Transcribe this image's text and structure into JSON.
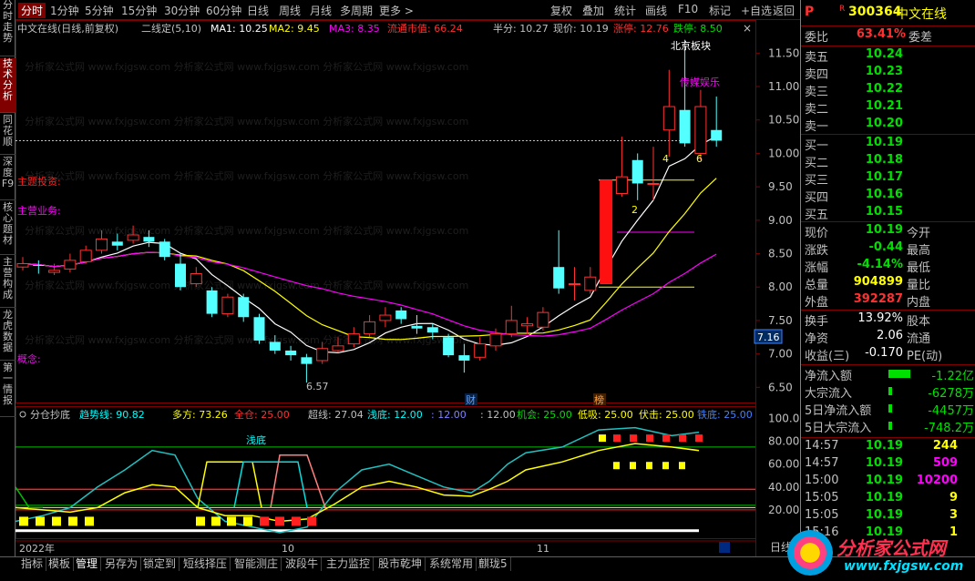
{
  "topbar": {
    "tabs": [
      "分时",
      "1分钟",
      "5分钟",
      "15分钟",
      "30分钟",
      "60分钟",
      "日线",
      "周线",
      "月线",
      "多周期",
      "更多 >"
    ],
    "active_tab": "分时",
    "right_tools": [
      "复权",
      "叠加",
      "统计",
      "画线",
      "F10",
      "标记",
      "+自选",
      "返回"
    ]
  },
  "leftbar": {
    "items": [
      "分时走势",
      "技术分析",
      "同花顺",
      "深度F9",
      "核心题材",
      "主营构成",
      "龙虎数据",
      "第一情报"
    ],
    "active": "技术分析"
  },
  "stock": {
    "code": "300364",
    "name": "中文在线",
    "p_mark": "P",
    "r_mark": "R"
  },
  "main_chart_header": {
    "title": "中文在线(日线,前复权)",
    "indicator": "二线定(5,10)",
    "ma1": "MA1: 10.25",
    "ma2": "MA2: 9.45",
    "ma3": "MA3: 8.35",
    "float_cap": "流通市值: 66.24",
    "half": "半分: 10.27",
    "price_now": "现价: 10.19",
    "limit_up": "涨停: 12.76",
    "limit_down": "跌停: 8.50",
    "close_btn": "×"
  },
  "main_chart_labels": {
    "theme": "主题投资:",
    "business": "主营业务:",
    "concept": "概念:",
    "beijing": "北京板块",
    "media": "传媒娱乐",
    "low_price": "6.57",
    "mark_cai": "财",
    "mark_bang": "榜",
    "n4": "4",
    "n6": "6",
    "n2": "2",
    "price_tag": "7.16"
  },
  "price_axis": [
    "11.50",
    "11.00",
    "10.50",
    "10.00",
    "9.50",
    "9.00",
    "8.50",
    "8.00",
    "7.50",
    "7.00",
    "6.50"
  ],
  "sub_chart_header": {
    "name": "分仓抄底",
    "trend": "趋势线: 90.82",
    "long": "多方: 73.26",
    "full": "全仓: 25.00",
    "super": "超线: 27.04",
    "shallow": "浅底: 12.00",
    "v12": ": 12.00",
    "v12b": ": 12.00",
    "chance": "机会: 25.00",
    "low_buy": "低吸: 25.00",
    "ambush": "伏击: 25.00",
    "iron": "铁底: 25.00",
    "shallow_label": "浅底"
  },
  "sub_axis": [
    "100.00",
    "80.00",
    "60.00",
    "40.00",
    "20.00"
  ],
  "date_axis": {
    "year": "2022年",
    "m10": "10",
    "m11": "11"
  },
  "right_panel": {
    "weibi_label": "委比",
    "weibi_val": "63.41%",
    "weicha_label": "委差",
    "sells": [
      {
        "label": "卖五",
        "price": "10.24"
      },
      {
        "label": "卖四",
        "price": "10.23"
      },
      {
        "label": "卖三",
        "price": "10.22"
      },
      {
        "label": "卖二",
        "price": "10.21"
      },
      {
        "label": "卖一",
        "price": "10.20"
      }
    ],
    "buys": [
      {
        "label": "买一",
        "price": "10.19"
      },
      {
        "label": "买二",
        "price": "10.18"
      },
      {
        "label": "买三",
        "price": "10.17"
      },
      {
        "label": "买四",
        "price": "10.16"
      },
      {
        "label": "买五",
        "price": "10.15"
      }
    ],
    "quotes": [
      {
        "l1": "现价",
        "v1": "10.19",
        "l2": "今开",
        "c": "green"
      },
      {
        "l1": "涨跌",
        "v1": "-0.44",
        "l2": "最高",
        "c": "green"
      },
      {
        "l1": "涨幅",
        "v1": "-4.14%",
        "l2": "最低",
        "c": "green"
      },
      {
        "l1": "总量",
        "v1": "904899",
        "l2": "量比",
        "c": "yellow"
      },
      {
        "l1": "外盘",
        "v1": "392287",
        "l2": "内盘",
        "c": "red"
      }
    ],
    "extra": [
      {
        "l1": "换手",
        "v1": "13.92%",
        "l2": "股本"
      },
      {
        "l1": "净资",
        "v1": "2.06",
        "l2": "流通"
      },
      {
        "l1": "收益(三)",
        "v1": "-0.170",
        "l2": "PE(动)"
      }
    ],
    "flows": [
      {
        "label": "净流入额",
        "val": "-1.22亿"
      },
      {
        "label": "大宗流入",
        "val": "-6278万"
      },
      {
        "label": "5日净流入额",
        "val": "-4457万"
      },
      {
        "label": "5日大宗流入",
        "val": "-748.2万"
      }
    ],
    "ticks": [
      {
        "time": "14:57",
        "price": "10.19",
        "vol": "244",
        "c": "yellow"
      },
      {
        "time": "14:57",
        "price": "10.19",
        "vol": "509",
        "c": "magenta"
      },
      {
        "time": "15:00",
        "price": "10.19",
        "vol": "10200",
        "c": "magenta"
      },
      {
        "time": "15:05",
        "price": "10.19",
        "vol": "9",
        "c": "yellow"
      },
      {
        "time": "15:05",
        "price": "10.19",
        "vol": "3",
        "c": "yellow"
      },
      {
        "time": "15:16",
        "price": "10.19",
        "vol": "1",
        "c": "yellow"
      }
    ]
  },
  "bottombar": {
    "items": [
      "指标",
      "模板",
      "管理",
      "另存为",
      "锁定到",
      "短线择压",
      "智能测庄",
      "波段牛",
      "主力监控",
      "股市乾坤",
      "系统常用",
      "麒珑5"
    ],
    "right": "日线"
  },
  "watermark": {
    "site": "分析家公式网",
    "url": "www.fxjgsw.com"
  },
  "chart_data": {
    "type": "candlestick",
    "ylim": [
      6.3,
      11.75
    ],
    "candles": [
      {
        "o": 8.3,
        "c": 8.35,
        "h": 8.45,
        "l": 8.25
      },
      {
        "o": 8.33,
        "c": 8.32,
        "h": 8.4,
        "l": 8.2
      },
      {
        "o": 8.22,
        "c": 8.25,
        "h": 8.35,
        "l": 8.18
      },
      {
        "o": 8.27,
        "c": 8.4,
        "h": 8.5,
        "l": 8.22
      },
      {
        "o": 8.38,
        "c": 8.55,
        "h": 8.62,
        "l": 8.35
      },
      {
        "o": 8.55,
        "c": 8.72,
        "h": 8.85,
        "l": 8.5
      },
      {
        "o": 8.68,
        "c": 8.62,
        "h": 8.8,
        "l": 8.55
      },
      {
        "o": 8.7,
        "c": 8.78,
        "h": 8.92,
        "l": 8.65
      },
      {
        "o": 8.75,
        "c": 8.68,
        "h": 8.85,
        "l": 8.6
      },
      {
        "o": 8.68,
        "c": 8.45,
        "h": 8.72,
        "l": 8.4
      },
      {
        "o": 8.35,
        "c": 8.0,
        "h": 8.5,
        "l": 7.95
      },
      {
        "o": 8.05,
        "c": 8.2,
        "h": 8.3,
        "l": 8.0
      },
      {
        "o": 7.95,
        "c": 7.6,
        "h": 8.0,
        "l": 7.55
      },
      {
        "o": 7.6,
        "c": 7.85,
        "h": 7.9,
        "l": 7.55
      },
      {
        "o": 7.85,
        "c": 7.55,
        "h": 7.9,
        "l": 7.48
      },
      {
        "o": 7.55,
        "c": 7.2,
        "h": 7.6,
        "l": 7.15
      },
      {
        "o": 7.18,
        "c": 7.05,
        "h": 7.28,
        "l": 7.0
      },
      {
        "o": 7.05,
        "c": 6.98,
        "h": 7.12,
        "l": 6.9
      },
      {
        "o": 6.95,
        "c": 6.85,
        "h": 7.0,
        "l": 6.57
      },
      {
        "o": 6.9,
        "c": 7.08,
        "h": 7.18,
        "l": 6.85
      },
      {
        "o": 7.05,
        "c": 7.12,
        "h": 7.25,
        "l": 7.02
      },
      {
        "o": 7.15,
        "c": 7.3,
        "h": 7.4,
        "l": 7.1
      },
      {
        "o": 7.3,
        "c": 7.48,
        "h": 7.58,
        "l": 7.25
      },
      {
        "o": 7.5,
        "c": 7.58,
        "h": 7.7,
        "l": 7.4
      },
      {
        "o": 7.65,
        "c": 7.52,
        "h": 7.7,
        "l": 7.45
      },
      {
        "o": 7.42,
        "c": 7.38,
        "h": 7.58,
        "l": 7.3
      },
      {
        "o": 7.4,
        "c": 7.32,
        "h": 7.45,
        "l": 7.22
      },
      {
        "o": 7.25,
        "c": 6.98,
        "h": 7.3,
        "l": 6.95
      },
      {
        "o": 6.98,
        "c": 6.9,
        "h": 7.15,
        "l": 6.72
      },
      {
        "o": 6.95,
        "c": 7.15,
        "h": 7.25,
        "l": 6.9
      },
      {
        "o": 7.12,
        "c": 7.3,
        "h": 7.38,
        "l": 7.05
      },
      {
        "o": 7.3,
        "c": 7.5,
        "h": 7.72,
        "l": 7.25
      },
      {
        "o": 7.42,
        "c": 7.45,
        "h": 7.55,
        "l": 7.3
      },
      {
        "o": 7.4,
        "c": 7.62,
        "h": 7.7,
        "l": 7.35
      },
      {
        "o": 8.3,
        "c": 7.98,
        "h": 8.85,
        "l": 7.9
      },
      {
        "o": 8.05,
        "c": 8.05,
        "h": 8.3,
        "l": 7.8
      },
      {
        "o": 7.95,
        "c": 8.15,
        "h": 8.3,
        "l": 7.9
      },
      {
        "o": 8.05,
        "c": 9.6,
        "h": 9.6,
        "l": 8.05
      },
      {
        "o": 9.4,
        "c": 9.65,
        "h": 10.25,
        "l": 9.35
      },
      {
        "o": 9.9,
        "c": 9.55,
        "h": 10.0,
        "l": 9.3
      },
      {
        "o": 9.55,
        "c": 9.55,
        "h": 10.1,
        "l": 9.3
      },
      {
        "o": 10.35,
        "c": 10.7,
        "h": 11.25,
        "l": 9.95
      },
      {
        "o": 10.65,
        "c": 10.15,
        "h": 11.7,
        "l": 10.1
      },
      {
        "o": 10.0,
        "c": 10.7,
        "h": 10.95,
        "l": 9.9
      },
      {
        "o": 10.35,
        "c": 10.19,
        "h": 10.85,
        "l": 10.1
      }
    ]
  }
}
